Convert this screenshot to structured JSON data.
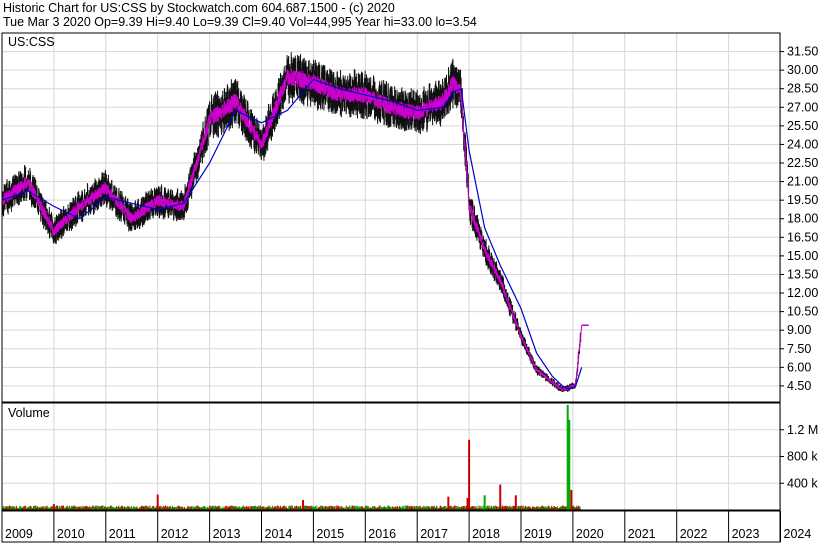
{
  "header": {
    "line1": "Historic Chart for US:CSS by Stockwatch.com 604.687.1500 - (c) 2020",
    "line2": "Tue Mar  3 2020   Op=9.39  Hi=9.40  Lo=9.39  Cl=9.40  Vol=44,995   Year hi=33.00   lo=3.54"
  },
  "chart_data": [
    {
      "type": "line",
      "title": "US:CSS",
      "ylim": [
        3.2,
        33.0
      ],
      "yticks": [
        4.5,
        6.0,
        7.5,
        9.0,
        10.5,
        12.0,
        13.5,
        15.0,
        16.5,
        18.0,
        19.5,
        21.0,
        22.5,
        24.0,
        25.5,
        27.0,
        28.5,
        30.0,
        31.5
      ],
      "ytick_labels": [
        "4.50",
        "6.00",
        "7.50",
        "9.00",
        "10.50",
        "12.00",
        "13.50",
        "15.00",
        "16.50",
        "18.00",
        "19.50",
        "21.00",
        "22.50",
        "24.00",
        "25.50",
        "27.00",
        "28.50",
        "30.00",
        "31.50"
      ],
      "grid": true,
      "x": [
        2009.0,
        2009.5,
        2010.0,
        2010.5,
        2011.0,
        2011.5,
        2012.0,
        2012.5,
        2013.0,
        2013.5,
        2014.0,
        2014.5,
        2015.0,
        2015.5,
        2016.0,
        2016.5,
        2017.0,
        2017.5,
        2017.7,
        2017.85,
        2018.0,
        2018.3,
        2018.6,
        2019.0,
        2019.3,
        2019.6,
        2019.8,
        2019.9,
        2020.05,
        2020.17
      ],
      "series": [
        {
          "values": [
            19.5,
            21.0,
            17.0,
            19.0,
            20.5,
            18.0,
            19.5,
            19.0,
            26.0,
            27.5,
            24.0,
            29.5,
            29.0,
            28.0,
            28.0,
            27.0,
            26.5,
            27.5,
            29.0,
            28.0,
            19.0,
            15.5,
            13.0,
            8.5,
            5.8,
            4.8,
            4.2,
            4.3,
            4.6,
            9.4
          ],
          "color": "#0000cc",
          "color_daily": "#cc00cc"
        }
      ]
    },
    {
      "type": "bar",
      "title": "Volume",
      "ylim": [
        0,
        1600000
      ],
      "yticks": [
        400000,
        800000,
        1200000
      ],
      "ytick_labels": [
        "400 k",
        "800 k",
        "1.2 M"
      ],
      "grid": true,
      "colors": {
        "up": "#00aa00",
        "down": "#cc0000"
      },
      "bars": [
        {
          "x": 2010.0,
          "value": 90000,
          "dir": "down"
        },
        {
          "x": 2012.0,
          "value": 230000,
          "dir": "down"
        },
        {
          "x": 2014.8,
          "value": 150000,
          "dir": "down"
        },
        {
          "x": 2017.6,
          "value": 200000,
          "dir": "down"
        },
        {
          "x": 2017.97,
          "value": 180000,
          "dir": "down"
        },
        {
          "x": 2018.0,
          "value": 1050000,
          "dir": "down"
        },
        {
          "x": 2018.3,
          "value": 220000,
          "dir": "up"
        },
        {
          "x": 2018.6,
          "value": 380000,
          "dir": "down"
        },
        {
          "x": 2018.9,
          "value": 220000,
          "dir": "down"
        },
        {
          "x": 2019.9,
          "value": 1650000,
          "dir": "up"
        },
        {
          "x": 2019.93,
          "value": 1350000,
          "dir": "up"
        },
        {
          "x": 2019.97,
          "value": 300000,
          "dir": "down"
        }
      ],
      "baseline_volume": 40000
    }
  ],
  "x_axis": {
    "years": [
      "2009",
      "2010",
      "2011",
      "2012",
      "2013",
      "2014",
      "2015",
      "2016",
      "2017",
      "2018",
      "2019",
      "2020",
      "2021",
      "2022",
      "2023",
      "2024"
    ],
    "start_year": 2009
  }
}
